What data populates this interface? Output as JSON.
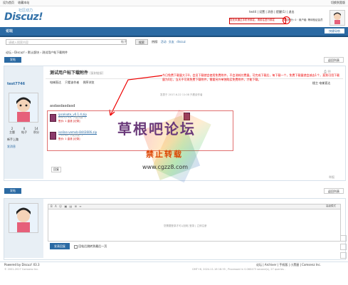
{
  "topbar": {
    "left_links": [
      "设为首页",
      "收藏本站"
    ],
    "right_link": "切换到宽版"
  },
  "header": {
    "logo_cn": "社区动力",
    "logo_en": "Discuz!",
    "user_line": "test4  |  设置  |  消息  |  提醒(1)  |  退出",
    "user_line2": "积分: 0 ·  用户组: 等待验证会员",
    "notice_text": "您还未通过手机号绑定，请前往进行绑定",
    "notice_badge": "绑定"
  },
  "nav": {
    "tab": "论坛",
    "quick": "快捷导航"
  },
  "search": {
    "placeholder": "请输入搜索内容",
    "scope": "帖子",
    "button": "搜索",
    "hot_label": "热搜:",
    "hot_items": [
      "活动",
      "交友",
      "discuz"
    ]
  },
  "breadcrumb": "论坛  ›  Discuz!  ›  默认版块  ›  测试用户帖下载附件",
  "thread": {
    "reply_button": "发帖",
    "back_button": "返回列表",
    "title": "测试用户帖下载附件",
    "title_link": "[复制链接]",
    "author": "test7746",
    "stats": [
      {
        "n": "2",
        "l": "主题"
      },
      {
        "n": "0",
        "l": "帖子"
      },
      {
        "n": "14",
        "l": "积分"
      }
    ],
    "rank": "新手上路",
    "send_msg": "发消息",
    "tools": [
      "电梯直达",
      "只看该作者",
      "倒序浏览"
    ],
    "floor": "楼主",
    "floor_label": "电梯直达",
    "postmeta": "发表于 2017-6-22 11:08  只看该作者",
    "body": "asdasdasdasd",
    "attachments": [
      {
        "name": "ipcoloate_v0.1.4.zip",
        "meta": "698.52 KB, 下载次数: 1",
        "dl": "售价: 1 金钱  [记录]"
      },
      {
        "name": "iseline-vemvb-8443606.zip",
        "meta": "7.65 KB, 下载次数: 1",
        "dl": "售价: 1 金钱  [记录]"
      }
    ],
    "report": "举报",
    "thumb_label": "回复"
  },
  "annotation": {
    "red_text": "今日免费下载量大于0，会员下载就会使用免费附件，不会消耗付费量。可完成下载后，每下载一个，免费下载量就会减去1个，直到可用下载量为0后，当天不可再免费下载附件，需要另外单独购买免费附件，才能下载。"
  },
  "watermark": {
    "line1": "草根吧论坛",
    "line2": "禁止转载",
    "url": "www.cgzz8.com"
  },
  "reply": {
    "button": "发帖",
    "back_button": "返回列表",
    "editor_mode": "高级模式",
    "editor_hint": "您需要登录才可以回帖  登录 | 立即注册",
    "submit": "发表回复",
    "checkbox": "回帖后跳转到最后一页"
  },
  "footer": {
    "powered": "Powered by Discuz! X3.3",
    "copyright": "© 2001-2017 Comsenz Inc.",
    "links": "论坛  |  Archiver  |  手机版  |  小黑屋  |  Comsenz Inc.",
    "gmt": "GMT+8, 2024-11-18 18:35 , Processed in 0.060473 second(s), 27 queries ."
  },
  "colors": {
    "brand": "#2b6aa3",
    "annotation": "#e00000"
  }
}
